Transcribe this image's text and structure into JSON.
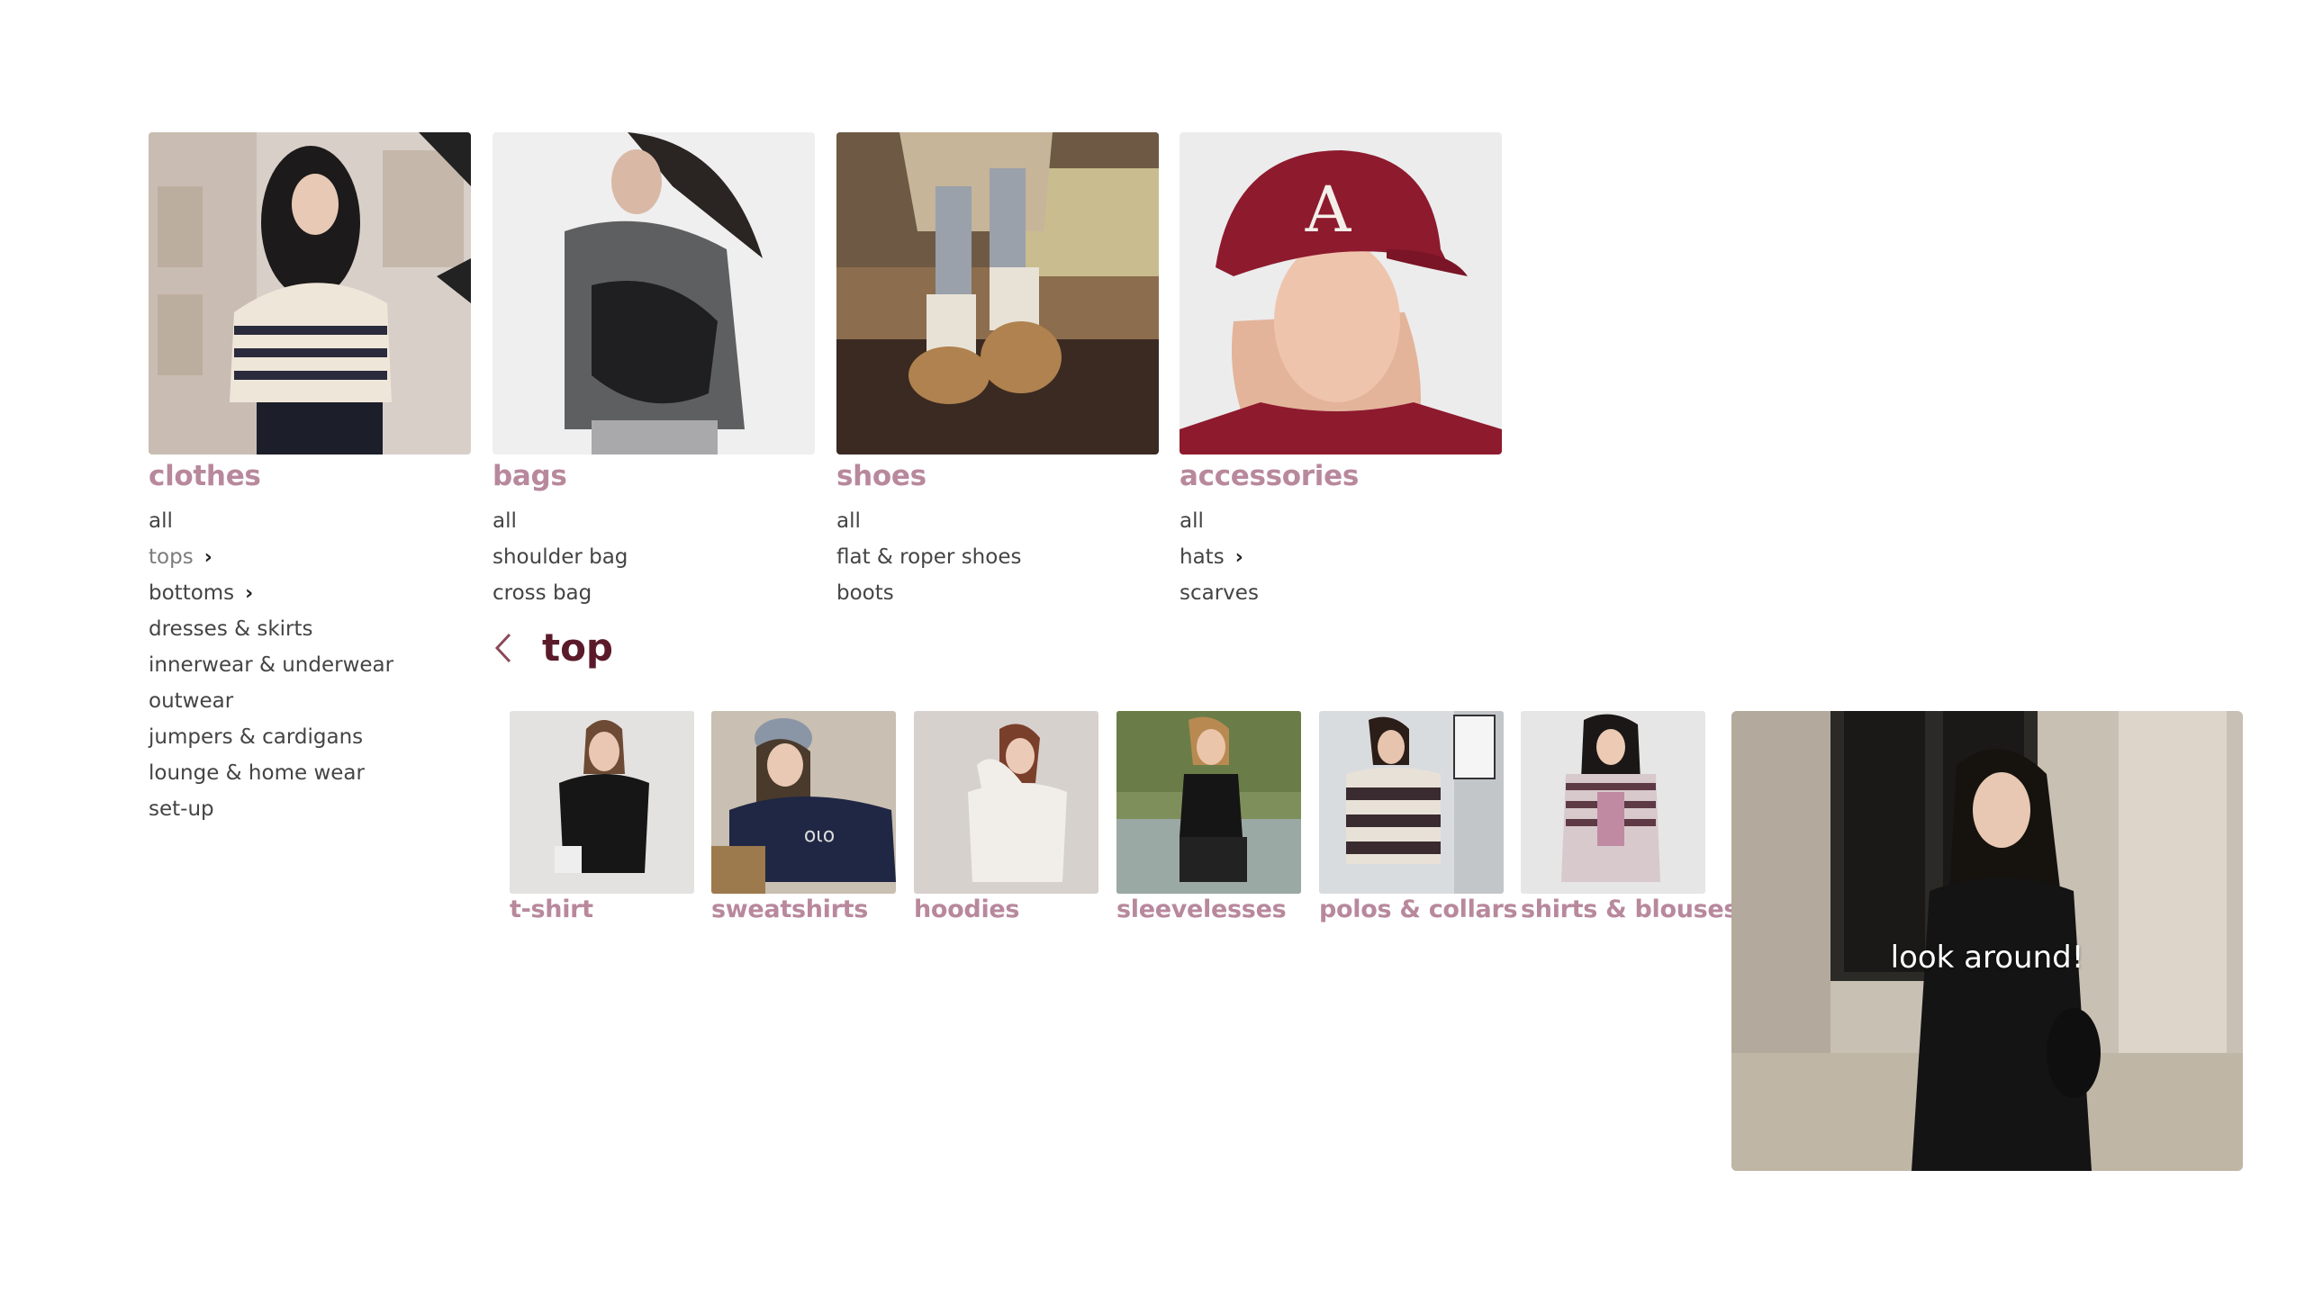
{
  "categories": [
    {
      "title": "clothes",
      "items": [
        {
          "label": "all",
          "chevron": false,
          "muted": false
        },
        {
          "label": "tops",
          "chevron": true,
          "muted": true
        },
        {
          "label": "bottoms",
          "chevron": true,
          "muted": false
        },
        {
          "label": "dresses & skirts",
          "chevron": false,
          "muted": false
        },
        {
          "label": "innerwear & underwear",
          "chevron": false,
          "muted": false
        },
        {
          "label": "outwear",
          "chevron": false,
          "muted": false
        },
        {
          "label": "jumpers & cardigans",
          "chevron": false,
          "muted": false
        },
        {
          "label": "lounge & home wear",
          "chevron": false,
          "muted": false
        },
        {
          "label": "set-up",
          "chevron": false,
          "muted": false
        }
      ]
    },
    {
      "title": "bags",
      "items": [
        {
          "label": "all",
          "chevron": false,
          "muted": false
        },
        {
          "label": "shoulder bag",
          "chevron": false,
          "muted": false
        },
        {
          "label": "cross bag",
          "chevron": false,
          "muted": false
        }
      ]
    },
    {
      "title": "shoes",
      "items": [
        {
          "label": "all",
          "chevron": false,
          "muted": false
        },
        {
          "label": "flat & roper shoes",
          "chevron": false,
          "muted": false
        },
        {
          "label": "boots",
          "chevron": false,
          "muted": false
        }
      ]
    },
    {
      "title": "accessories",
      "items": [
        {
          "label": "all",
          "chevron": false,
          "muted": false
        },
        {
          "label": "hats",
          "chevron": true,
          "muted": false
        },
        {
          "label": "scarves",
          "chevron": false,
          "muted": false
        }
      ]
    }
  ],
  "chevron_glyph": "›",
  "subsection": {
    "title": "top",
    "back_icon": "chevron-left-icon",
    "items": [
      {
        "label": "t-shirt"
      },
      {
        "label": "sweatshirts"
      },
      {
        "label": "hoodies"
      },
      {
        "label": "sleevelesses"
      },
      {
        "label": "polos & collars"
      },
      {
        "label": "shirts & blouses"
      }
    ]
  },
  "promo": {
    "label": "look around!"
  },
  "colors": {
    "category_title": "#b8889c",
    "sub_title": "#5b1a2a",
    "item_text": "#444444",
    "item_muted": "#7c7c7c"
  }
}
